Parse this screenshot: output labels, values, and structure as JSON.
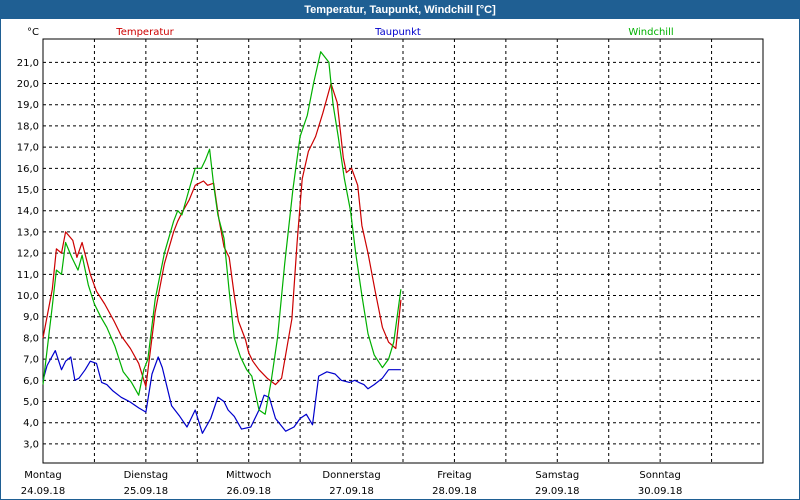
{
  "window": {
    "title": "Temperatur, Taupunkt, Windchill [°C]"
  },
  "colors": {
    "temperatur": "#cc0000",
    "taupunkt": "#0000cc",
    "windchill": "#00b000",
    "titlebar": "#1f5f93"
  },
  "chart_data": {
    "type": "line",
    "title": "Temperatur, Taupunkt, Windchill [°C]",
    "ylabel": "°C",
    "ylim": [
      3.0,
      21.0
    ],
    "yticks": [
      "3,0",
      "4,0",
      "5,0",
      "6,0",
      "7,0",
      "8,0",
      "9,0",
      "10,0",
      "11,0",
      "12,0",
      "13,0",
      "14,0",
      "15,0",
      "16,0",
      "17,0",
      "18,0",
      "19,0",
      "20,0",
      "21,0"
    ],
    "xlim": [
      0,
      7
    ],
    "xticks": [
      {
        "day": "Montag",
        "date": "24.09.18"
      },
      {
        "day": "Dienstag",
        "date": "25.09.18"
      },
      {
        "day": "Mittwoch",
        "date": "26.09.18"
      },
      {
        "day": "Donnerstag",
        "date": "27.09.18"
      },
      {
        "day": "Freitag",
        "date": "28.09.18"
      },
      {
        "day": "Samstag",
        "date": "29.09.18"
      },
      {
        "day": "Sonntag",
        "date": "30.09.18"
      }
    ],
    "grid": true,
    "legend_position": "top",
    "series": [
      {
        "name": "Temperatur",
        "x": [
          0.0,
          0.09,
          0.13,
          0.18,
          0.22,
          0.29,
          0.33,
          0.38,
          0.46,
          0.52,
          0.6,
          0.69,
          0.76,
          0.85,
          0.93,
          1.0,
          1.09,
          1.18,
          1.27,
          1.31,
          1.35,
          1.42,
          1.48,
          1.56,
          1.6,
          1.66,
          1.71,
          1.76,
          1.81,
          1.86,
          1.9,
          1.97,
          2.0,
          2.04,
          2.1,
          2.18,
          2.26,
          2.32,
          2.42,
          2.47,
          2.52,
          2.58,
          2.65,
          2.72,
          2.8,
          2.86,
          2.92,
          2.95,
          3.0,
          3.06,
          3.1,
          3.16,
          3.23,
          3.3,
          3.36,
          3.43,
          3.48
        ],
        "y": [
          8.0,
          10.3,
          12.2,
          12.0,
          13.0,
          12.6,
          11.8,
          12.5,
          11.0,
          10.2,
          9.6,
          8.8,
          8.1,
          7.5,
          6.8,
          5.7,
          9.2,
          11.5,
          13.0,
          13.5,
          13.9,
          14.5,
          15.2,
          15.4,
          15.2,
          15.3,
          13.6,
          12.3,
          11.8,
          10.0,
          8.8,
          7.9,
          7.3,
          6.9,
          6.5,
          6.1,
          5.8,
          6.1,
          8.9,
          12.5,
          15.5,
          16.8,
          17.5,
          18.6,
          20.0,
          19.1,
          16.5,
          15.8,
          16.0,
          15.2,
          13.3,
          12.0,
          10.2,
          8.5,
          7.8,
          7.5,
          9.8
        ]
      },
      {
        "name": "Taupunkt",
        "x": [
          0.0,
          0.04,
          0.12,
          0.18,
          0.22,
          0.27,
          0.31,
          0.35,
          0.41,
          0.46,
          0.52,
          0.57,
          0.62,
          0.68,
          0.76,
          0.84,
          0.93,
          1.0,
          1.06,
          1.12,
          1.16,
          1.25,
          1.33,
          1.4,
          1.48,
          1.55,
          1.63,
          1.7,
          1.76,
          1.8,
          1.86,
          1.93,
          2.02,
          2.1,
          2.15,
          2.2,
          2.26,
          2.36,
          2.44,
          2.5,
          2.56,
          2.62,
          2.68,
          2.76,
          2.84,
          2.9,
          2.98,
          3.03,
          3.07,
          3.12,
          3.16,
          3.22,
          3.3,
          3.36,
          3.42,
          3.48
        ],
        "y": [
          6.0,
          6.7,
          7.4,
          6.5,
          6.9,
          7.1,
          6.0,
          6.1,
          6.5,
          6.9,
          6.8,
          5.9,
          5.8,
          5.5,
          5.2,
          5.0,
          4.7,
          4.5,
          6.3,
          7.1,
          6.6,
          4.8,
          4.3,
          3.8,
          4.6,
          3.5,
          4.2,
          5.2,
          5.0,
          4.6,
          4.3,
          3.7,
          3.8,
          4.6,
          5.3,
          5.2,
          4.2,
          3.6,
          3.8,
          4.2,
          4.4,
          3.9,
          6.2,
          6.4,
          6.3,
          6.0,
          5.9,
          6.0,
          5.9,
          5.8,
          5.6,
          5.8,
          6.1,
          6.5,
          6.5,
          6.5
        ]
      },
      {
        "name": "Windchill",
        "x": [
          0.0,
          0.09,
          0.13,
          0.18,
          0.22,
          0.28,
          0.34,
          0.38,
          0.44,
          0.5,
          0.56,
          0.62,
          0.7,
          0.78,
          0.86,
          0.93,
          0.98,
          1.02,
          1.09,
          1.18,
          1.27,
          1.31,
          1.35,
          1.42,
          1.48,
          1.54,
          1.58,
          1.62,
          1.66,
          1.7,
          1.76,
          1.81,
          1.86,
          1.92,
          1.98,
          2.03,
          2.1,
          2.16,
          2.22,
          2.28,
          2.35,
          2.43,
          2.5,
          2.57,
          2.63,
          2.7,
          2.78,
          2.82,
          2.87,
          2.93,
          2.99,
          3.04,
          3.1,
          3.16,
          3.22,
          3.3,
          3.36,
          3.41,
          3.48
        ],
        "y": [
          5.8,
          9.5,
          11.2,
          11.0,
          12.5,
          11.8,
          11.2,
          11.9,
          10.5,
          9.6,
          9.0,
          8.5,
          7.6,
          6.4,
          5.9,
          5.3,
          6.5,
          7.0,
          9.8,
          12.0,
          13.5,
          14.0,
          13.8,
          15.0,
          16.0,
          16.0,
          16.4,
          16.9,
          15.2,
          13.8,
          12.7,
          10.2,
          8.0,
          7.1,
          6.5,
          6.2,
          4.6,
          4.4,
          6.0,
          8.0,
          11.5,
          15.0,
          17.5,
          18.5,
          20.0,
          21.5,
          21.0,
          19.0,
          17.5,
          15.5,
          14.0,
          12.0,
          10.0,
          8.2,
          7.2,
          6.6,
          7.0,
          7.8,
          10.3
        ]
      }
    ]
  }
}
